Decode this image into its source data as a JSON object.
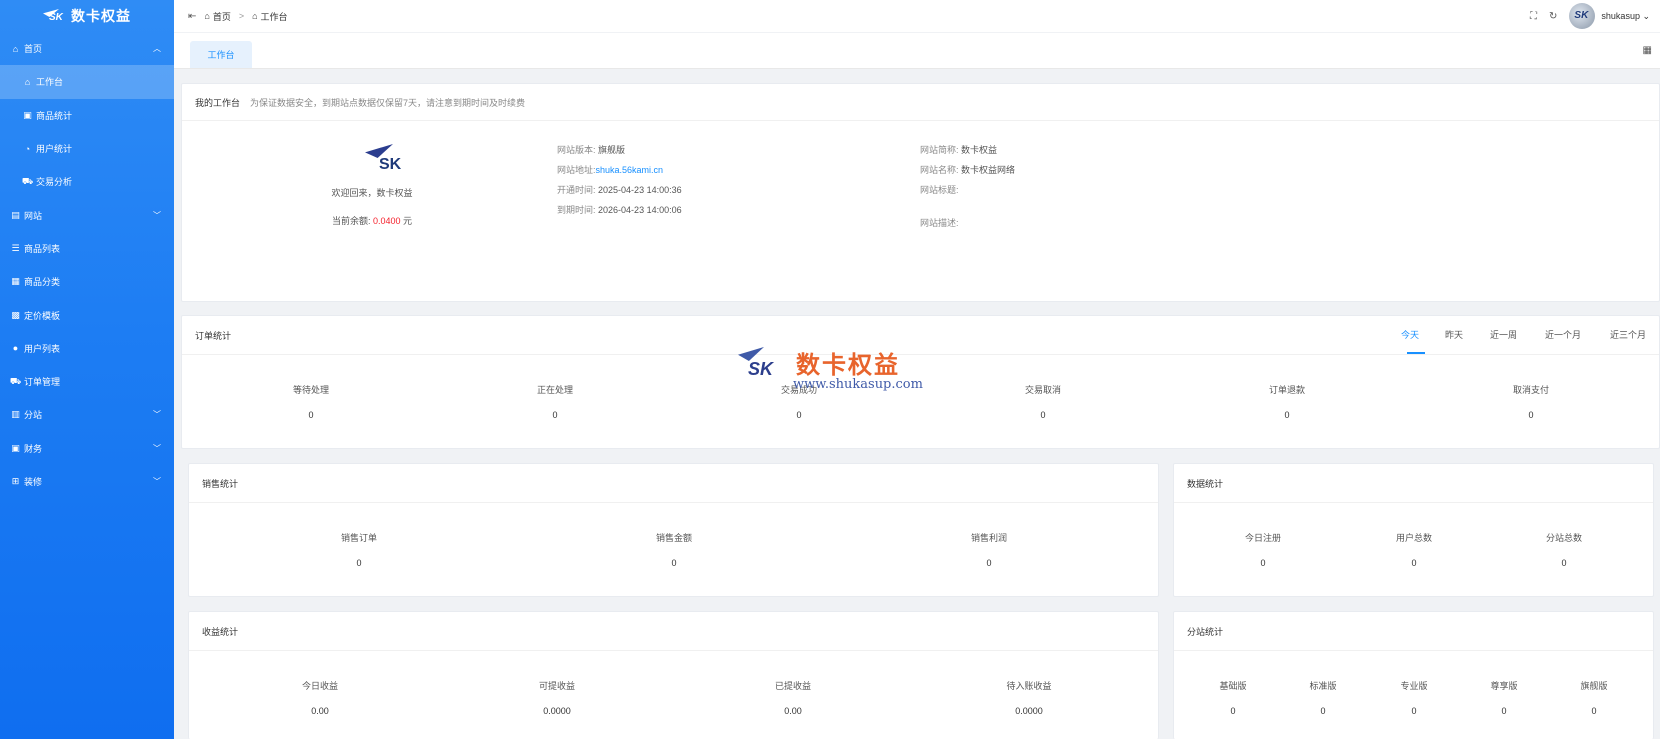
{
  "app": {
    "logo_text": "SK",
    "title": "数卡权益"
  },
  "sidebar": {
    "items": [
      {
        "label": "首页",
        "icon": "home-icon",
        "level": 0,
        "chevron": "︿"
      },
      {
        "label": "工作台",
        "icon": "home-icon",
        "level": 1,
        "active": true
      },
      {
        "label": "商品统计",
        "icon": "shop-icon",
        "level": 1
      },
      {
        "label": "用户统计",
        "icon": "clock-icon",
        "level": 1
      },
      {
        "label": "交易分析",
        "icon": "cart-icon",
        "level": 1
      },
      {
        "label": "网站",
        "icon": "website-icon",
        "level": 0,
        "chevron": "﹀"
      },
      {
        "label": "商品列表",
        "icon": "list-icon",
        "level": 0
      },
      {
        "label": "商品分类",
        "icon": "category-icon",
        "level": 0
      },
      {
        "label": "定价模板",
        "icon": "template-icon",
        "level": 0
      },
      {
        "label": "用户列表",
        "icon": "user-icon",
        "level": 0
      },
      {
        "label": "订单管理",
        "icon": "cart-icon",
        "level": 0
      },
      {
        "label": "分站",
        "icon": "substation-icon",
        "level": 0,
        "chevron": "﹀"
      },
      {
        "label": "财务",
        "icon": "finance-icon",
        "level": 0,
        "chevron": "﹀"
      },
      {
        "label": "装修",
        "icon": "decorate-icon",
        "level": 0,
        "chevron": "﹀"
      }
    ]
  },
  "header": {
    "breadcrumb": [
      "首页",
      "工作台"
    ],
    "user_name": "shukasup",
    "avatar_text": "SK"
  },
  "tabs": {
    "active": "工作台"
  },
  "workbench": {
    "title": "我的工作台",
    "note": "为保证数据安全，到期站点数据仅保留7天，请注意到期时间及时续费",
    "welcome": "欢迎回来，数卡权益",
    "balance_label": "当前余额:",
    "balance_value": "0.0400",
    "balance_unit": "元",
    "version_label": "网站版本:",
    "version_value": "旗舰版",
    "url_label": "网站地址:",
    "url_value": "shuka.56kami.cn",
    "open_label": "开通时间:",
    "open_value": "2025-04-23 14:00:36",
    "expire_label": "到期时间:",
    "expire_value": "2026-04-23 14:00:06",
    "short_name_label": "网站简称:",
    "short_name_value": "数卡权益",
    "name_label": "网站名称:",
    "name_value": "数卡权益网络",
    "site_title_label": "网站标题:",
    "desc_label": "网站描述:"
  },
  "orders": {
    "title": "订单统计",
    "periods": [
      "今天",
      "昨天",
      "近一周",
      "近一个月",
      "近三个月"
    ],
    "active_period": "今天",
    "stats": [
      {
        "label": "等待处理",
        "value": "0"
      },
      {
        "label": "正在处理",
        "value": "0"
      },
      {
        "label": "交易成功",
        "value": "0"
      },
      {
        "label": "交易取消",
        "value": "0"
      },
      {
        "label": "订单退款",
        "value": "0"
      },
      {
        "label": "取消支付",
        "value": "0"
      }
    ]
  },
  "sales": {
    "title": "销售统计",
    "stats": [
      {
        "label": "销售订单",
        "value": "0"
      },
      {
        "label": "销售金额",
        "value": "0"
      },
      {
        "label": "销售利润",
        "value": "0"
      }
    ]
  },
  "data_stats": {
    "title": "数据统计",
    "stats": [
      {
        "label": "今日注册",
        "value": "0"
      },
      {
        "label": "用户总数",
        "value": "0"
      },
      {
        "label": "分站总数",
        "value": "0"
      }
    ]
  },
  "income": {
    "title": "收益统计",
    "stats": [
      {
        "label": "今日收益",
        "value": "0.00"
      },
      {
        "label": "可提收益",
        "value": "0.0000"
      },
      {
        "label": "已提收益",
        "value": "0.00"
      },
      {
        "label": "待入账收益",
        "value": "0.0000"
      }
    ]
  },
  "substation": {
    "title": "分站统计",
    "stats": [
      {
        "label": "基础版",
        "value": "0"
      },
      {
        "label": "标准版",
        "value": "0"
      },
      {
        "label": "专业版",
        "value": "0"
      },
      {
        "label": "尊享版",
        "value": "0"
      },
      {
        "label": "旗舰版",
        "value": "0"
      }
    ]
  },
  "watermark": {
    "logo": "SK",
    "title": "数卡权益",
    "url": "www.shukasup.com"
  },
  "colors": {
    "accent": "#1890ff",
    "sidebar": "#1d7df3",
    "balance": "#f5222d",
    "watermark_title": "#e8642c"
  }
}
